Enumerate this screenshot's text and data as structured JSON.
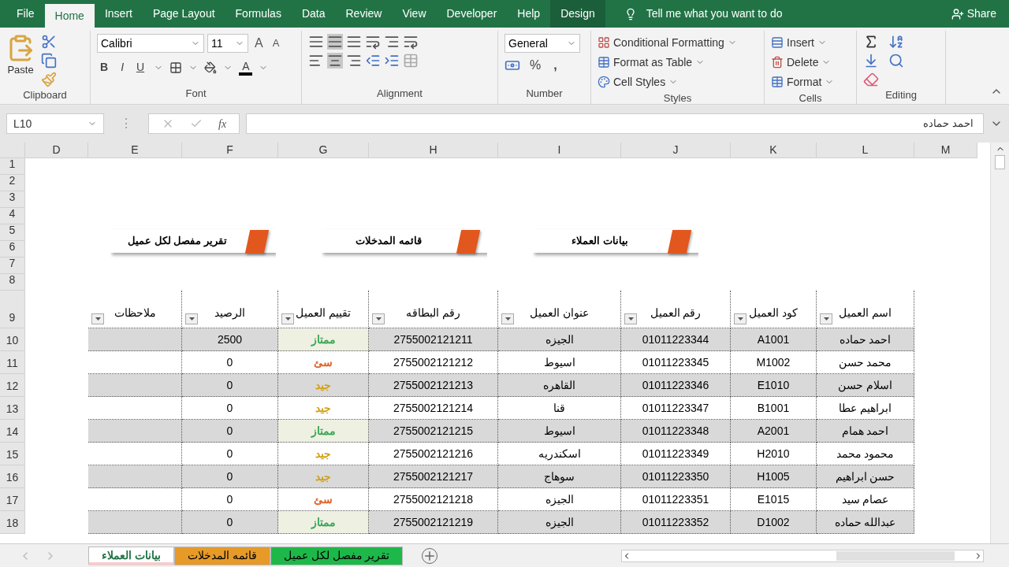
{
  "menu_tabs": [
    {
      "label": "Design",
      "selected": false,
      "contextual": true
    },
    {
      "label": "Help",
      "selected": false,
      "contextual": false
    },
    {
      "label": "Developer",
      "selected": false,
      "contextual": false
    },
    {
      "label": "View",
      "selected": false,
      "contextual": false
    },
    {
      "label": "Review",
      "selected": false,
      "contextual": false
    },
    {
      "label": "Data",
      "selected": false,
      "contextual": false
    },
    {
      "label": "Formulas",
      "selected": false,
      "contextual": false
    },
    {
      "label": "Page Layout",
      "selected": false,
      "contextual": false
    },
    {
      "label": "Insert",
      "selected": false,
      "contextual": false
    },
    {
      "label": "Home",
      "selected": true,
      "contextual": false
    },
    {
      "label": "File",
      "selected": false,
      "contextual": false
    }
  ],
  "tell_me": "Tell me what you want to do",
  "share": "Share",
  "ribbon": {
    "clipboard": {
      "label": "Clipboard",
      "paste": "Paste"
    },
    "font": {
      "label": "Font",
      "name": "Calibri",
      "size": "11",
      "bold": "B",
      "italic": "I",
      "underline": "U",
      "font_color": "A",
      "grow": "A",
      "shrink": "A"
    },
    "alignment": {
      "label": "Alignment"
    },
    "number": {
      "label": "Number",
      "format": "General",
      "percent": "%",
      "comma": ","
    },
    "styles": {
      "label": "Styles",
      "items": [
        "Conditional Formatting",
        "Format as Table",
        "Cell Styles"
      ]
    },
    "cells": {
      "label": "Cells",
      "items": [
        "Insert",
        "Delete",
        "Format"
      ]
    },
    "editing": {
      "label": "Editing"
    }
  },
  "formula_bar": {
    "name_box": "L10",
    "separator": "⋮",
    "fx": "fx",
    "value": "احمد حماده"
  },
  "column_letters": [
    "M",
    "L",
    "K",
    "J",
    "I",
    "H",
    "G",
    "F",
    "E",
    "D"
  ],
  "row_numbers": [
    "1",
    "2",
    "3",
    "4",
    "5",
    "6",
    "7",
    "8",
    "9",
    "10",
    "11",
    "12",
    "13",
    "14",
    "15",
    "16",
    "17",
    "18"
  ],
  "shape_buttons": [
    {
      "label": "بيانات العملاء"
    },
    {
      "label": "قائمه المدخلات"
    },
    {
      "label": "تقرير مفصل لكل عميل"
    }
  ],
  "table": {
    "columns": [
      "اسم العميل",
      "كود العميل",
      "رقم العميل",
      "عنوان العميل",
      "رقم البطاقه",
      "تقييم العميل",
      "الرصيد",
      "ملاحظات"
    ],
    "rows": [
      {
        "name": "احمد حماده",
        "code": "A1001",
        "phone": "01011223344",
        "address": "الجيزه",
        "card": "2755002121211",
        "rating": {
          "text": "ممتاز",
          "color": "#3aa655"
        },
        "balance": "2500"
      },
      {
        "name": "محمد حسن",
        "code": "M1002",
        "phone": "01011223345",
        "address": "اسيوط",
        "card": "2755002121212",
        "rating": {
          "text": "سئ",
          "color": "#e0622a"
        },
        "balance": "0"
      },
      {
        "name": "اسلام حسن",
        "code": "E1010",
        "phone": "01011223346",
        "address": "القاهره",
        "card": "2755002121213",
        "rating": {
          "text": "جيد",
          "color": "#d4a017"
        },
        "balance": "0"
      },
      {
        "name": "ابراهيم عطا",
        "code": "B1001",
        "phone": "01011223347",
        "address": "قنا",
        "card": "2755002121214",
        "rating": {
          "text": "جيد",
          "color": "#d4a017"
        },
        "balance": "0"
      },
      {
        "name": "احمد همام",
        "code": "A2001",
        "phone": "01011223348",
        "address": "اسيوط",
        "card": "2755002121215",
        "rating": {
          "text": "ممتاز",
          "color": "#3aa655"
        },
        "balance": "0"
      },
      {
        "name": "محمود محمد",
        "code": "H2010",
        "phone": "01011223349",
        "address": "اسكندريه",
        "card": "2755002121216",
        "rating": {
          "text": "جيد",
          "color": "#d4a017"
        },
        "balance": "0"
      },
      {
        "name": "حسن ابراهيم",
        "code": "H1005",
        "phone": "01011223350",
        "address": "سوهاج",
        "card": "2755002121217",
        "rating": {
          "text": "جيد",
          "color": "#d4a017"
        },
        "balance": "0"
      },
      {
        "name": "عصام سيد",
        "code": "E1015",
        "phone": "01011223351",
        "address": "الجيزه",
        "card": "2755002121218",
        "rating": {
          "text": "سئ",
          "color": "#e0622a"
        },
        "balance": "0"
      },
      {
        "name": "عبدالله حماده",
        "code": "D1002",
        "phone": "01011223352",
        "address": "الجيزه",
        "card": "2755002121219",
        "rating": {
          "text": "ممتاز",
          "color": "#3aa655"
        },
        "balance": "0"
      }
    ]
  },
  "sheet_tabs": [
    {
      "label": "تقرير مفصل لكل عميل",
      "selected": false,
      "color": "#1eb84a"
    },
    {
      "label": "قائمه المدخلات",
      "selected": false,
      "color": "#e69a28"
    },
    {
      "label": "بيانات العملاء",
      "selected": true,
      "color": "#f4cccc"
    }
  ]
}
